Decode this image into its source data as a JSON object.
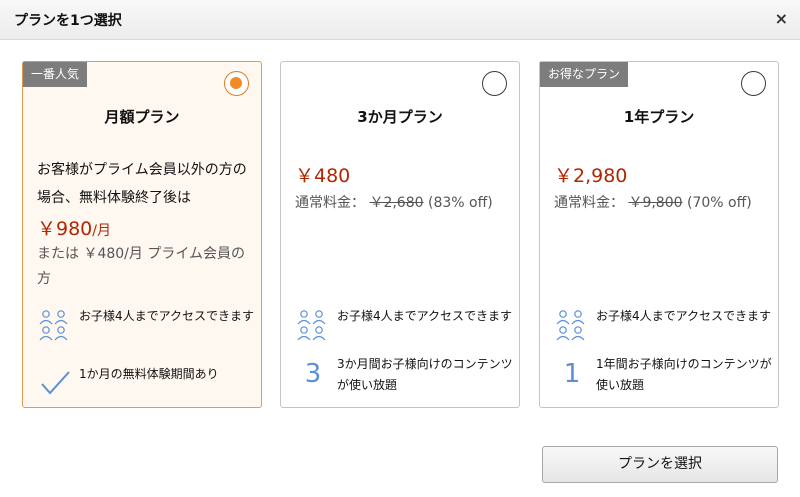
{
  "dialog": {
    "title": "プランを1つ選択",
    "close_glyph": "×"
  },
  "cards": [
    {
      "tag": "一番人気",
      "name": "月額プラン",
      "selected": true,
      "desc": "お客様がプライム会員以外の方の場合、無料体験終了後は",
      "price": "￥980",
      "price_unit": "/月",
      "alt": "または ￥480/月 プライム会員の方",
      "features": [
        {
          "icon": "family-icon",
          "text": "お子様4人までアクセスできます"
        },
        {
          "icon": "checkmark-icon",
          "text": "1か月の無料体験期間あり"
        }
      ]
    },
    {
      "tag": "",
      "name": "3か月プラン",
      "selected": false,
      "price": "￥480",
      "regular_label": "通常料金：",
      "regular_price": "￥2,680",
      "discount": "(83% off)",
      "features": [
        {
          "icon": "family-icon",
          "text": "お子様4人までアクセスできます"
        },
        {
          "icon": "number-3-icon",
          "glyph": "3",
          "text": "3か月間お子様向けのコンテンツが使い放題"
        }
      ]
    },
    {
      "tag": "お得なプラン",
      "name": "1年プラン",
      "selected": false,
      "price": "￥2,980",
      "regular_label": "通常料金：",
      "regular_price": "￥9,800",
      "discount": "(70% off)",
      "features": [
        {
          "icon": "family-icon",
          "text": "お子様4人までアクセスできます"
        },
        {
          "icon": "number-1-icon",
          "glyph": "1",
          "text": "1年間お子様向けのコンテンツが使い放題"
        }
      ]
    }
  ],
  "select_button": "プランを選択",
  "colors": {
    "accent": "#f08b28",
    "price": "#b12704",
    "icon": "#5b8fd6",
    "tag_bg": "#7d7d7d"
  }
}
